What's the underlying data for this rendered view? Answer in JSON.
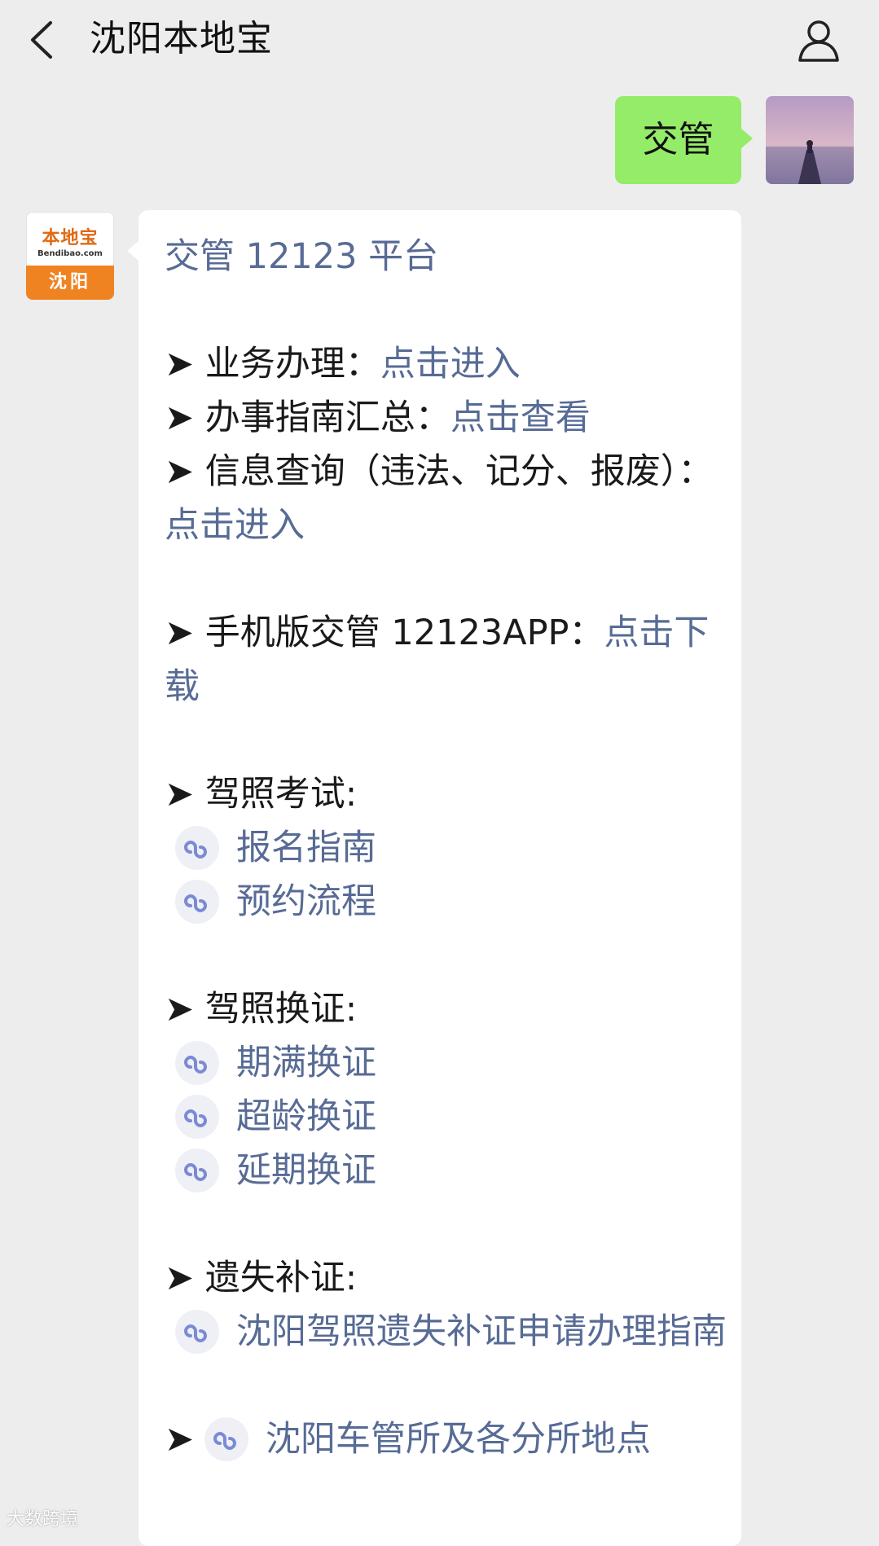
{
  "header": {
    "title": "沈阳本地宝",
    "back_icon": "back-arrow-icon",
    "profile_icon": "person-icon"
  },
  "sent": {
    "text": "交管"
  },
  "bot_avatar": {
    "logo": "本地宝",
    "domain": "Bendibao.com",
    "city": "沈阳"
  },
  "message": {
    "title": "交管 12123 平台",
    "items": [
      {
        "label": "➤ 业务办理：",
        "link": "点击进入"
      },
      {
        "label": "➤ 办事指南汇总：",
        "link": "点击查看"
      },
      {
        "label": "➤ 信息查询（违法、记分、报废）：",
        "link": "点击进入"
      }
    ],
    "app": {
      "label": "➤ 手机版交管 12123APP：",
      "link": "点击下载"
    },
    "exam": {
      "heading": "➤ 驾照考试:",
      "links": [
        "报名指南",
        "预约流程"
      ]
    },
    "renew": {
      "heading": "➤ 驾照换证:",
      "links": [
        "期满换证",
        "超龄换证",
        "延期换证"
      ]
    },
    "lost": {
      "heading": "➤ 遗失补证:",
      "links": [
        "沈阳驾照遗失补证申请办理指南"
      ]
    },
    "office": {
      "arrow": "➤",
      "link": "沈阳车管所及各分所地点"
    }
  },
  "watermark": {
    "text": "大数跨境"
  }
}
